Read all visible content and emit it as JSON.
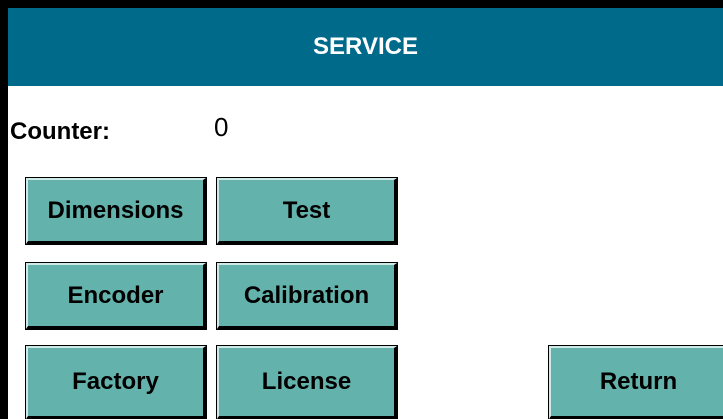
{
  "header": {
    "title": "SERVICE"
  },
  "counter": {
    "label": "Counter:",
    "value": "0"
  },
  "buttons": {
    "dimensions": "Dimensions",
    "test": "Test",
    "encoder": "Encoder",
    "calibration": "Calibration",
    "factory": "Factory",
    "license": "License",
    "return": "Return"
  },
  "colors": {
    "header_bg": "#006a8a",
    "button_bg": "#63b2ac",
    "frame": "#000000"
  }
}
